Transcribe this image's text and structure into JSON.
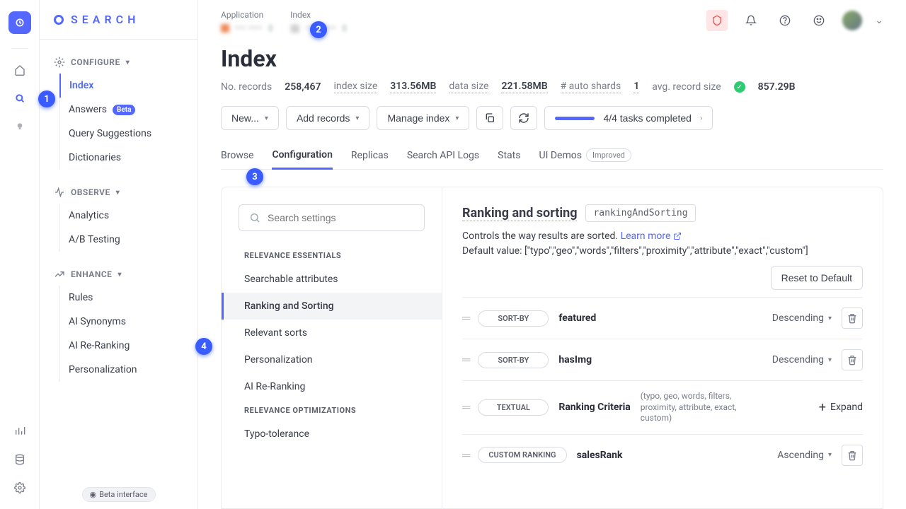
{
  "brand": {
    "title": "SEARCH"
  },
  "rail": {
    "items": [
      "logo",
      "home",
      "search",
      "bulb"
    ],
    "bottom": [
      "chart",
      "db",
      "gear"
    ]
  },
  "sidebar": {
    "sections": [
      {
        "header": "CONFIGURE",
        "items": [
          {
            "label": "Index",
            "active": true
          },
          {
            "label": "Answers",
            "badge": "Beta"
          },
          {
            "label": "Query Suggestions"
          },
          {
            "label": "Dictionaries"
          }
        ]
      },
      {
        "header": "OBSERVE",
        "items": [
          {
            "label": "Analytics"
          },
          {
            "label": "A/B Testing"
          }
        ]
      },
      {
        "header": "ENHANCE",
        "items": [
          {
            "label": "Rules"
          },
          {
            "label": "AI Synonyms"
          },
          {
            "label": "AI Re-Ranking"
          },
          {
            "label": "Personalization"
          }
        ]
      }
    ],
    "beta_label": "Beta interface"
  },
  "topbar": {
    "app_label": "Application",
    "index_label": "Index",
    "app_value": "••• ••••",
    "index_value": "••• •••••"
  },
  "page": {
    "title": "Index",
    "stats": {
      "records_label": "No. records",
      "records": "258,467",
      "index_size_label": "index size",
      "index_size": "313.56MB",
      "data_size_label": "data size",
      "data_size": "221.58MB",
      "shards_label": "# auto shards",
      "shards": "1",
      "avg_label": "avg. record size",
      "avg": "857.29B"
    },
    "actions": {
      "new": "New...",
      "add": "Add records",
      "manage": "Manage index",
      "tasks": "4/4 tasks completed"
    },
    "tabs": [
      "Browse",
      "Configuration",
      "Replicas",
      "Search API Logs",
      "Stats",
      "UI Demos"
    ],
    "tabs_active": 1,
    "improved": "Improved"
  },
  "settings_nav": {
    "search_placeholder": "Search settings",
    "categories": [
      {
        "header": "RELEVANCE ESSENTIALS",
        "items": [
          "Searchable attributes",
          "Ranking and Sorting",
          "Relevant sorts",
          "Personalization",
          "AI Re-Ranking"
        ],
        "active": 1
      },
      {
        "header": "RELEVANCE OPTIMIZATIONS",
        "items": [
          "Typo-tolerance"
        ]
      }
    ]
  },
  "setting": {
    "title": "Ranking and sorting",
    "code": "rankingAndSorting",
    "desc": "Controls the way results are sorted.",
    "learn": "Learn more",
    "default_label": "Default value: [\"typo\",\"geo\",\"words\",\"filters\",\"proximity\",\"attribute\",\"exact\",\"custom\"]",
    "reset": "Reset to Default",
    "rules": [
      {
        "tag": "SORT-BY",
        "name": "featured",
        "dir": "Descending",
        "delete": true
      },
      {
        "tag": "SORT-BY",
        "name": "hasImg",
        "dir": "Descending",
        "delete": true
      },
      {
        "tag": "TEXTUAL",
        "name": "Ranking Criteria",
        "sub": "(typo, geo, words, filters, proximity, attribute, exact, custom)",
        "expand": "Expand"
      },
      {
        "tag": "CUSTOM RANKING",
        "name": "salesRank",
        "dir": "Ascending",
        "delete": true
      }
    ]
  },
  "markers": {
    "1": "1",
    "2": "2",
    "3": "3",
    "4": "4"
  }
}
